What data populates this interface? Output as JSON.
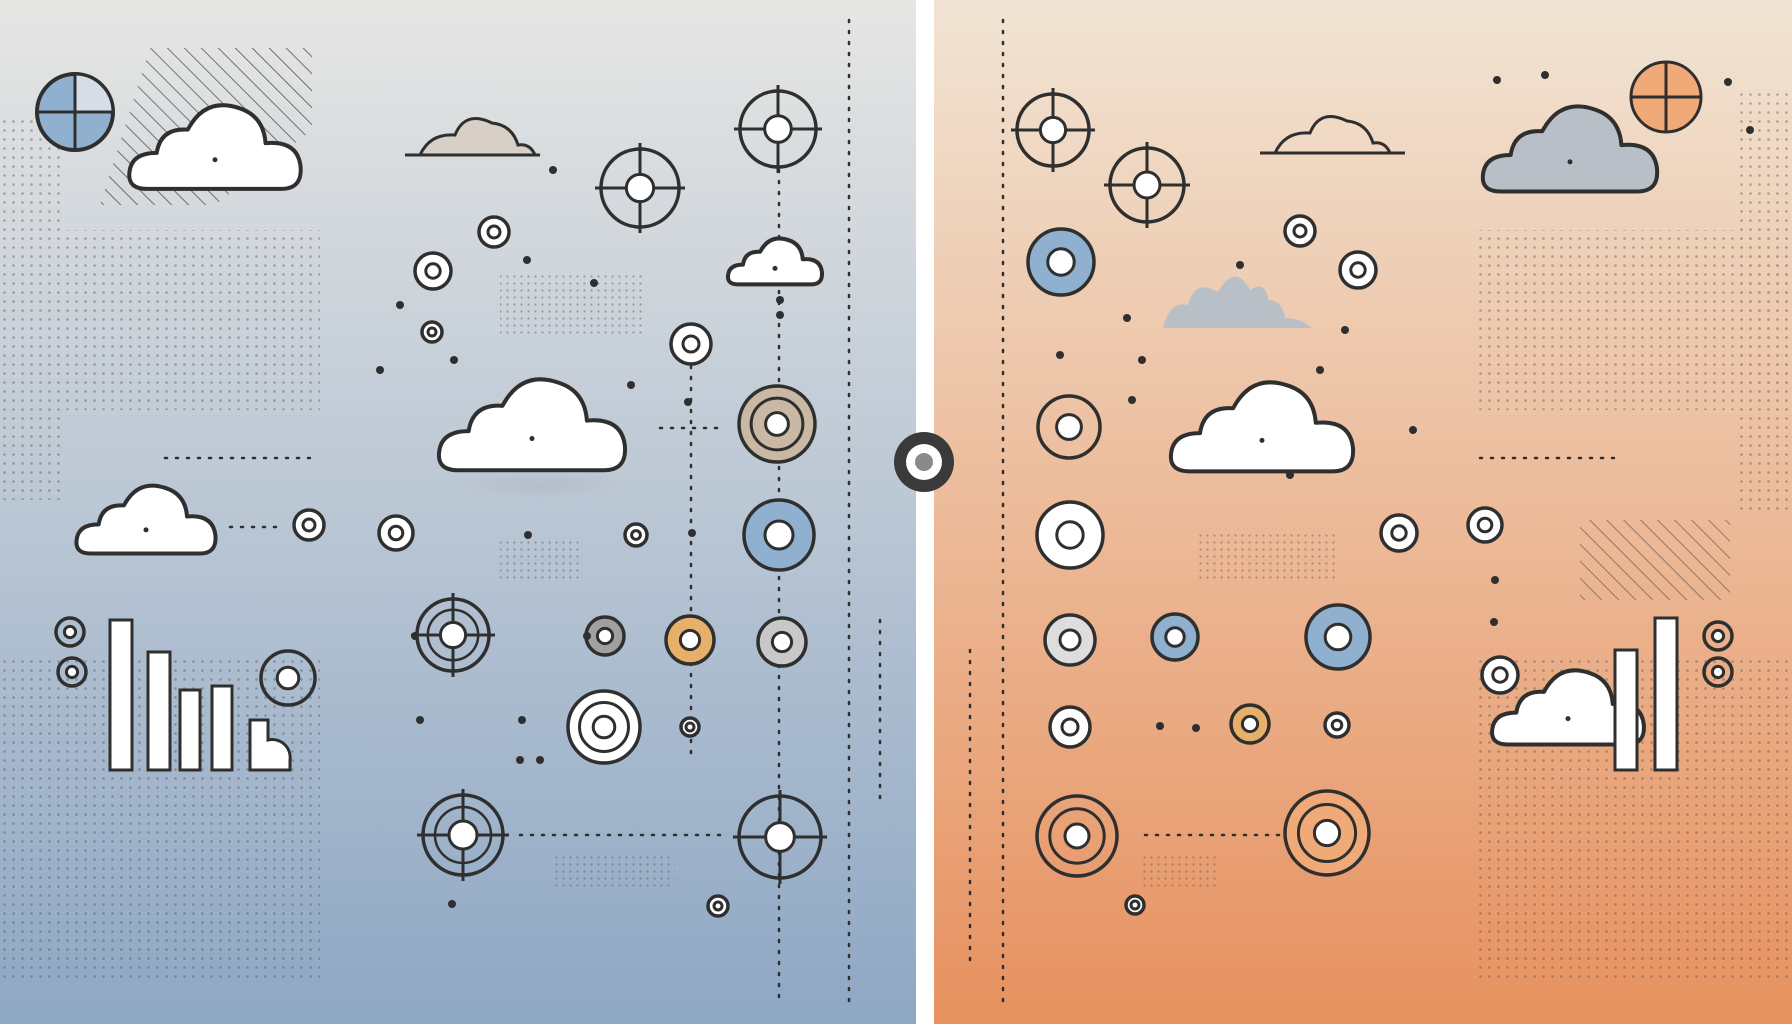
{
  "left_panel": {
    "name": "cool-panel",
    "gradient_top": "#e6e6e4",
    "gradient_bottom": "#8ea7c4",
    "accent": "#9fb7d0"
  },
  "right_panel": {
    "name": "warm-panel",
    "gradient_top": "#f1e4d4",
    "gradient_bottom": "#e7915f",
    "accent": "#f0aa78"
  },
  "divider": {
    "color": "#ffffff",
    "knob_icon": "toggle-knob-icon"
  },
  "colors": {
    "stroke": "#2f2f2f",
    "cloud_fill": "#ffffff",
    "cloud_grey": "#b9bfc6",
    "dot_texture": "#5a5a5a",
    "gold": "#e6b06a",
    "blue": "#8fb0cf",
    "orange": "#f0aa78"
  },
  "icons": [
    "cloud-icon",
    "target-icon",
    "ring-icon",
    "dot-icon",
    "pie-chart-icon",
    "bar-chart-icon",
    "compass-icon",
    "crosshair-icon"
  ]
}
